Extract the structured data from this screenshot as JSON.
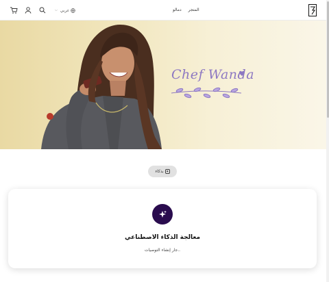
{
  "header": {
    "language_label": "عربي",
    "nav": [
      {
        "label": "المتجر"
      },
      {
        "label": "دمالو"
      }
    ]
  },
  "hero": {
    "signature": "Chef Wanda"
  },
  "ai_pill": {
    "label": "بذكاء"
  },
  "card": {
    "title": "معالجة الذكاء الاصطناعي",
    "subtitle": "جار إنشاء التوصيات.."
  },
  "colors": {
    "accent": "#2a0c4e",
    "signature": "#8d78c2",
    "hero_bg": "#f1e6bd"
  }
}
